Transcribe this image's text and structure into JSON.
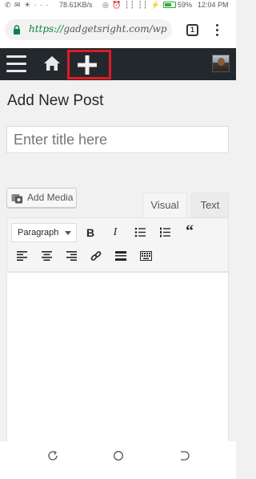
{
  "status_bar": {
    "left_icons": "✆ ✉ ☀ · · ·",
    "speed": "78.61KB/s",
    "mid_icons": "◎ ⏰ ┆┆ ┆┆ ⚡",
    "battery": "59%",
    "time": "12:04 PM"
  },
  "browser": {
    "url_scheme": "https://",
    "url_rest": "gadgetsright.com/wp",
    "tab_count": "1"
  },
  "admin_bar": {
    "icons": [
      "menu-icon",
      "home-icon",
      "plus-icon",
      "avatar"
    ]
  },
  "page": {
    "title": "Add New Post",
    "title_placeholder": "Enter title here",
    "add_media_label": "Add Media",
    "tabs": [
      "Visual",
      "Text"
    ],
    "format_select": "Paragraph"
  },
  "accent_colors": {
    "admin_bar": "#23282d",
    "highlight": "#e01b24",
    "url_scheme": "#0b8043"
  }
}
